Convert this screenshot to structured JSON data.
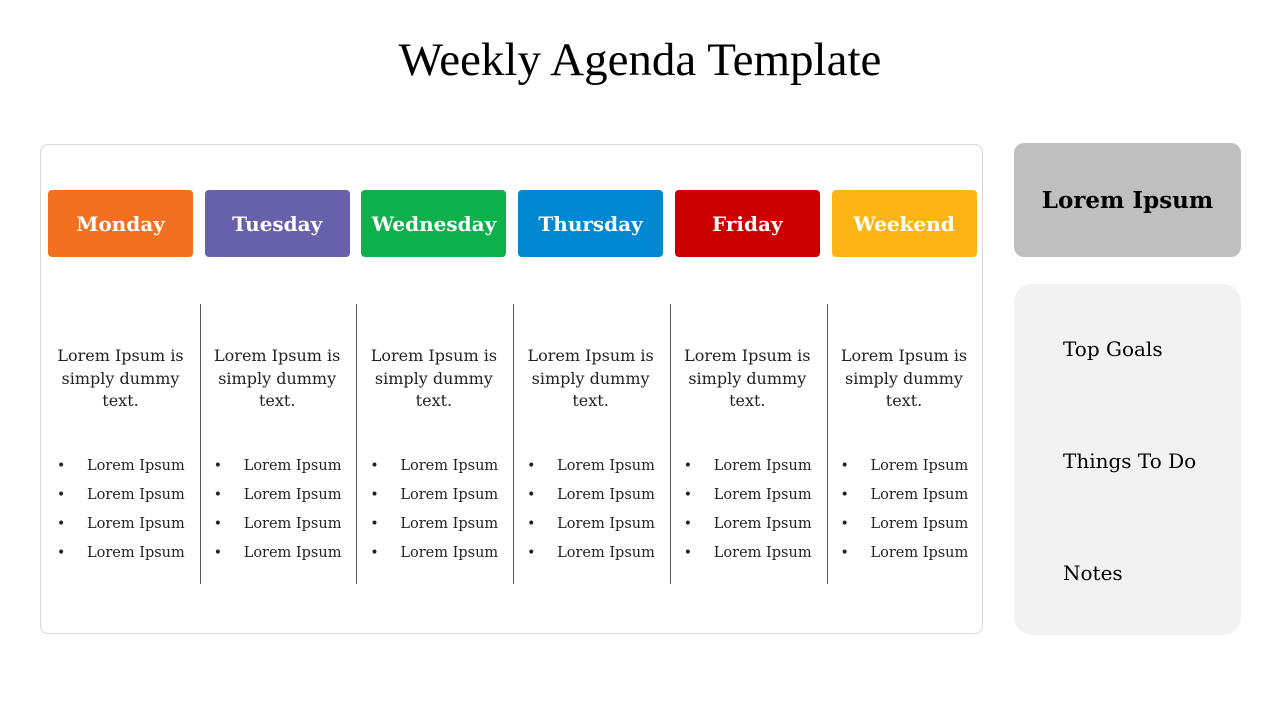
{
  "title": "Weekly Agenda Template",
  "days": [
    {
      "label": "Monday",
      "color": "#F37021",
      "description": "Lorem Ipsum is simply dummy text.",
      "items": [
        "Lorem Ipsum",
        "Lorem Ipsum",
        "Lorem Ipsum",
        "Lorem Ipsum"
      ]
    },
    {
      "label": "Tuesday",
      "color": "#6661AA",
      "description": "Lorem Ipsum is simply dummy text.",
      "items": [
        "Lorem Ipsum",
        "Lorem Ipsum",
        "Lorem Ipsum",
        "Lorem Ipsum"
      ]
    },
    {
      "label": "Wednesday",
      "color": "#0DB04B",
      "description": "Lorem Ipsum is simply dummy text.",
      "items": [
        "Lorem Ipsum",
        "Lorem Ipsum",
        "Lorem Ipsum",
        "Lorem Ipsum"
      ]
    },
    {
      "label": "Thursday",
      "color": "#0288D1",
      "description": "Lorem Ipsum is simply dummy text.",
      "items": [
        "Lorem Ipsum",
        "Lorem Ipsum",
        "Lorem Ipsum",
        "Lorem Ipsum"
      ]
    },
    {
      "label": "Friday",
      "color": "#CC0000",
      "description": "Lorem Ipsum is simply dummy text.",
      "items": [
        "Lorem Ipsum",
        "Lorem Ipsum",
        "Lorem Ipsum",
        "Lorem Ipsum"
      ]
    },
    {
      "label": "Weekend",
      "color": "#FDB515",
      "description": "Lorem Ipsum is simply dummy text.",
      "items": [
        "Lorem Ipsum",
        "Lorem Ipsum",
        "Lorem Ipsum",
        "Lorem Ipsum"
      ]
    }
  ],
  "bullet_glyph": "•",
  "sidebar": {
    "header": "Lorem Ipsum",
    "header_color": "#BFBFBF",
    "panel_color": "#F2F2F2",
    "items": [
      "Top Goals",
      "Things To Do",
      "Notes"
    ]
  }
}
